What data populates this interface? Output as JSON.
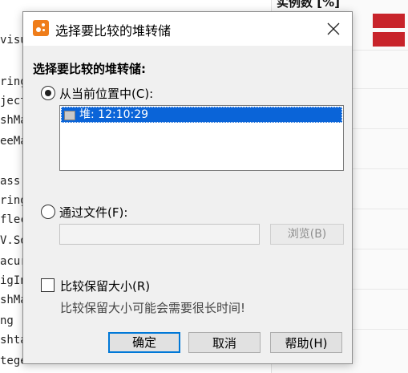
{
  "background": {
    "code_lines": [
      "visu",
      "ring",
      "ject",
      "shMa",
      "eeMa",
      "ass",
      "ring",
      "flec",
      "V.So",
      "acur",
      "igIn",
      "shMa",
      "ng",
      "shta",
      "teger"
    ],
    "right_panel_header": "实例数 [%]"
  },
  "dialog": {
    "title": "选择要比较的堆转储",
    "section_label": "选择要比较的堆转储:",
    "option_current": {
      "label": "从当前位置中(C):",
      "selected": true
    },
    "heap_list": {
      "items": [
        {
          "label": "堆: 12:10:29",
          "selected": true
        }
      ]
    },
    "option_file": {
      "label": "通过文件(F):",
      "selected": false
    },
    "file_input": {
      "value": ""
    },
    "browse_button": "浏览(B)",
    "compare_retained": {
      "label": "比较保留大小(R)",
      "checked": false,
      "hint": "比较保留大小可能会需要很长时间!"
    },
    "buttons": {
      "ok": "确定",
      "cancel": "取消",
      "help": "帮助(H)"
    }
  },
  "colors": {
    "accent": "#0a64d8",
    "app_icon": "#ef7d1a",
    "background_bar": "#c8242b"
  }
}
